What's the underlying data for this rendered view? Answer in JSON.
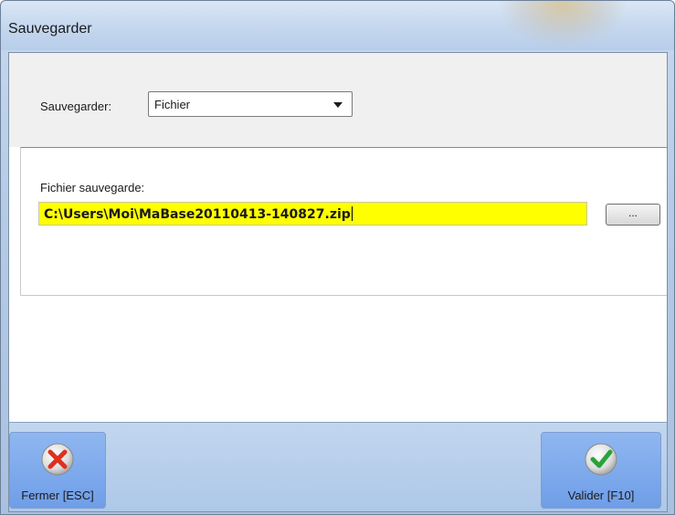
{
  "window": {
    "title": "Sauvegarder"
  },
  "backup": {
    "label": "Sauvegarder:",
    "selected": "Fichier"
  },
  "file": {
    "label": "Fichier sauvegarde:",
    "path": "C:\\Users\\Moi\\MaBase20110413-140827.zip",
    "browse_label": "..."
  },
  "footer": {
    "close_label": "Fermer [ESC]",
    "ok_label": "Valider [F10]"
  },
  "icons": {
    "close": "red-x-icon",
    "ok": "green-check-icon"
  },
  "colors": {
    "path_field_bg": "#ffff00",
    "footer_button": "#7aa6ec"
  }
}
